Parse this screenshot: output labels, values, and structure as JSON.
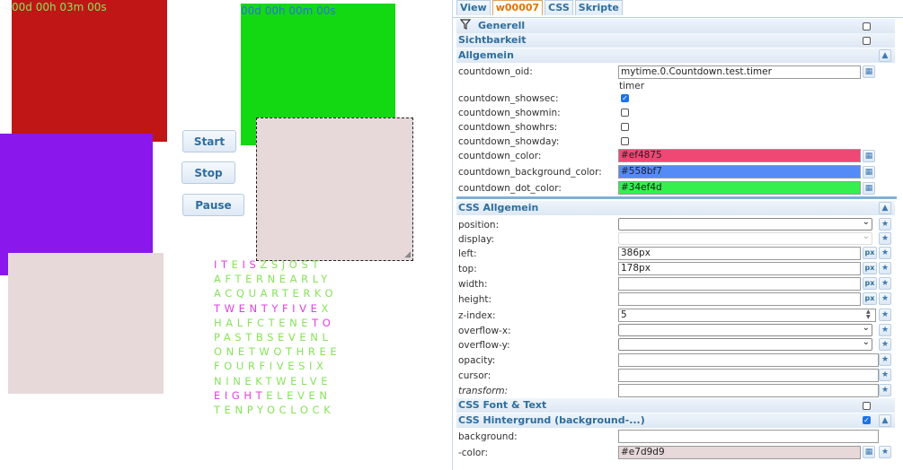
{
  "timers": {
    "red": {
      "text": "00d 00h 03m 00s"
    },
    "green": {
      "text": "00d 00h 00m 00s"
    }
  },
  "buttons": {
    "start": "Start",
    "stop": "Stop",
    "pause": "Pause"
  },
  "word_clock": {
    "active_color": "#e040e0",
    "inactive_color": "#86e35a",
    "rows": [
      [
        [
          "I",
          "a"
        ],
        [
          "T",
          "a"
        ],
        [
          "E",
          "i"
        ],
        [
          "I",
          "a"
        ],
        [
          "S",
          "a"
        ],
        [
          "Z",
          "i"
        ],
        [
          "S",
          "i"
        ],
        [
          "J",
          "i"
        ],
        [
          "O",
          "i"
        ],
        [
          "S",
          "i"
        ],
        [
          "T",
          "i"
        ]
      ],
      [
        [
          "A",
          "i"
        ],
        [
          "F",
          "i"
        ],
        [
          "T",
          "i"
        ],
        [
          "E",
          "i"
        ],
        [
          "R",
          "i"
        ],
        [
          "N",
          "i"
        ],
        [
          "E",
          "i"
        ],
        [
          "A",
          "i"
        ],
        [
          "R",
          "i"
        ],
        [
          "L",
          "i"
        ],
        [
          "Y",
          "i"
        ]
      ],
      [
        [
          "A",
          "i"
        ],
        [
          "C",
          "i"
        ],
        [
          "Q",
          "i"
        ],
        [
          "U",
          "i"
        ],
        [
          "A",
          "i"
        ],
        [
          "R",
          "i"
        ],
        [
          "T",
          "i"
        ],
        [
          "E",
          "i"
        ],
        [
          "R",
          "i"
        ],
        [
          "K",
          "i"
        ],
        [
          "O",
          "i"
        ]
      ],
      [
        [
          "T",
          "a"
        ],
        [
          "W",
          "a"
        ],
        [
          "E",
          "a"
        ],
        [
          "N",
          "a"
        ],
        [
          "T",
          "a"
        ],
        [
          "Y",
          "a"
        ],
        [
          "F",
          "a"
        ],
        [
          "I",
          "a"
        ],
        [
          "V",
          "a"
        ],
        [
          "E",
          "a"
        ],
        [
          "X",
          "i"
        ]
      ],
      [
        [
          "H",
          "i"
        ],
        [
          "A",
          "i"
        ],
        [
          "L",
          "i"
        ],
        [
          "F",
          "i"
        ],
        [
          "C",
          "i"
        ],
        [
          "T",
          "i"
        ],
        [
          "E",
          "i"
        ],
        [
          "N",
          "i"
        ],
        [
          "E",
          "i"
        ],
        [
          "T",
          "a"
        ],
        [
          "O",
          "a"
        ]
      ],
      [
        [
          "P",
          "i"
        ],
        [
          "A",
          "i"
        ],
        [
          "S",
          "i"
        ],
        [
          "T",
          "i"
        ],
        [
          "B",
          "i"
        ],
        [
          "S",
          "i"
        ],
        [
          "E",
          "i"
        ],
        [
          "V",
          "i"
        ],
        [
          "E",
          "i"
        ],
        [
          "N",
          "i"
        ],
        [
          "L",
          "i"
        ]
      ],
      [
        [
          "O",
          "i"
        ],
        [
          "N",
          "i"
        ],
        [
          "E",
          "i"
        ],
        [
          "T",
          "i"
        ],
        [
          "W",
          "i"
        ],
        [
          "O",
          "i"
        ],
        [
          "T",
          "i"
        ],
        [
          "H",
          "i"
        ],
        [
          "R",
          "i"
        ],
        [
          "E",
          "i"
        ],
        [
          "E",
          "i"
        ]
      ],
      [
        [
          "F",
          "i"
        ],
        [
          "O",
          "i"
        ],
        [
          "U",
          "i"
        ],
        [
          "R",
          "i"
        ],
        [
          "F",
          "i"
        ],
        [
          "I",
          "i"
        ],
        [
          "V",
          "i"
        ],
        [
          "E",
          "i"
        ],
        [
          "S",
          "i"
        ],
        [
          "I",
          "i"
        ],
        [
          "X",
          "i"
        ]
      ],
      [
        [
          "N",
          "i"
        ],
        [
          "I",
          "i"
        ],
        [
          "N",
          "i"
        ],
        [
          "E",
          "i"
        ],
        [
          "K",
          "i"
        ],
        [
          "T",
          "i"
        ],
        [
          "W",
          "i"
        ],
        [
          "E",
          "i"
        ],
        [
          "L",
          "i"
        ],
        [
          "V",
          "i"
        ],
        [
          "E",
          "i"
        ]
      ],
      [
        [
          "E",
          "a"
        ],
        [
          "I",
          "a"
        ],
        [
          "G",
          "a"
        ],
        [
          "H",
          "a"
        ],
        [
          "T",
          "a"
        ],
        [
          "E",
          "i"
        ],
        [
          "L",
          "i"
        ],
        [
          "E",
          "i"
        ],
        [
          "V",
          "i"
        ],
        [
          "E",
          "i"
        ],
        [
          "N",
          "i"
        ]
      ],
      [
        [
          "T",
          "i"
        ],
        [
          "E",
          "i"
        ],
        [
          "N",
          "i"
        ],
        [
          "P",
          "i"
        ],
        [
          "Y",
          "i"
        ],
        [
          "O",
          "i"
        ],
        [
          "C",
          "i"
        ],
        [
          "L",
          "i"
        ],
        [
          "O",
          "i"
        ],
        [
          "C",
          "i"
        ],
        [
          "K",
          "i"
        ]
      ]
    ]
  },
  "inspector": {
    "tabs": [
      "View",
      "w00007",
      "CSS",
      "Skripte"
    ],
    "groups": {
      "generell": "Generell",
      "sichtbarkeit": "Sichtbarkeit",
      "allgemein": "Allgemein",
      "css_allgemein": "CSS Allgemein",
      "css_font": "CSS Font & Text",
      "css_hintergrund": "CSS Hintergrund (background-...)"
    },
    "allgemein": {
      "countdown_oid_label": "countdown_oid:",
      "countdown_oid_value": "mytime.0.Countdown.test.timer",
      "countdown_oid_hint": "timer",
      "showsec_label": "countdown_showsec:",
      "showmin_label": "countdown_showmin:",
      "showhrs_label": "countdown_showhrs:",
      "showday_label": "countdown_showday:",
      "color_label": "countdown_color:",
      "color_value": "#ef4875",
      "bg_color_label": "countdown_background_color:",
      "bg_color_value": "#558bf7",
      "dot_color_label": "countdown_dot_color:",
      "dot_color_value": "#34ef4d"
    },
    "css_allgemein": {
      "position_label": "position:",
      "display_label": "display:",
      "left_label": "left:",
      "left_value": "386px",
      "top_label": "top:",
      "top_value": "178px",
      "width_label": "width:",
      "height_label": "height:",
      "zindex_label": "z-index:",
      "zindex_value": "5",
      "overflowx_label": "overflow-x:",
      "overflowy_label": "overflow-y:",
      "opacity_label": "opacity:",
      "cursor_label": "cursor:",
      "transform_label": "transform:",
      "px_unit": "px"
    },
    "hintergrund": {
      "background_label": "background:",
      "color_label": "-color:",
      "color_value": "#e7d9d9"
    }
  }
}
